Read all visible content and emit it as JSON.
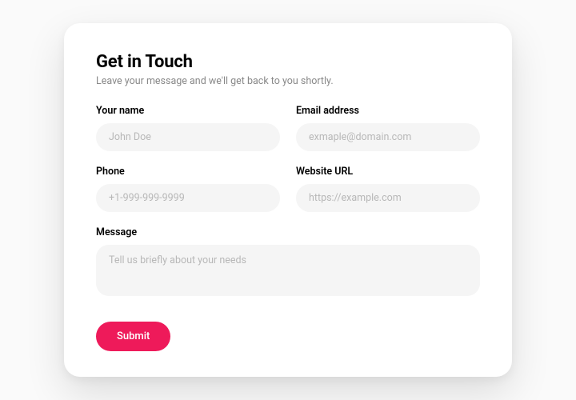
{
  "header": {
    "title": "Get in Touch",
    "subtitle": "Leave your message and we'll get back to you shortly."
  },
  "fields": {
    "name": {
      "label": "Your name",
      "placeholder": "John Doe",
      "value": ""
    },
    "email": {
      "label": "Email address",
      "placeholder": "exmaple@domain.com",
      "value": ""
    },
    "phone": {
      "label": "Phone",
      "placeholder": "+1-999-999-9999",
      "value": ""
    },
    "website": {
      "label": "Website URL",
      "placeholder": "https://example.com",
      "value": ""
    },
    "message": {
      "label": "Message",
      "placeholder": "Tell us briefly about your needs",
      "value": ""
    }
  },
  "actions": {
    "submit_label": "Submit"
  },
  "colors": {
    "accent": "#ee1a5a",
    "input_bg": "#f5f5f5",
    "text_muted": "#888"
  }
}
